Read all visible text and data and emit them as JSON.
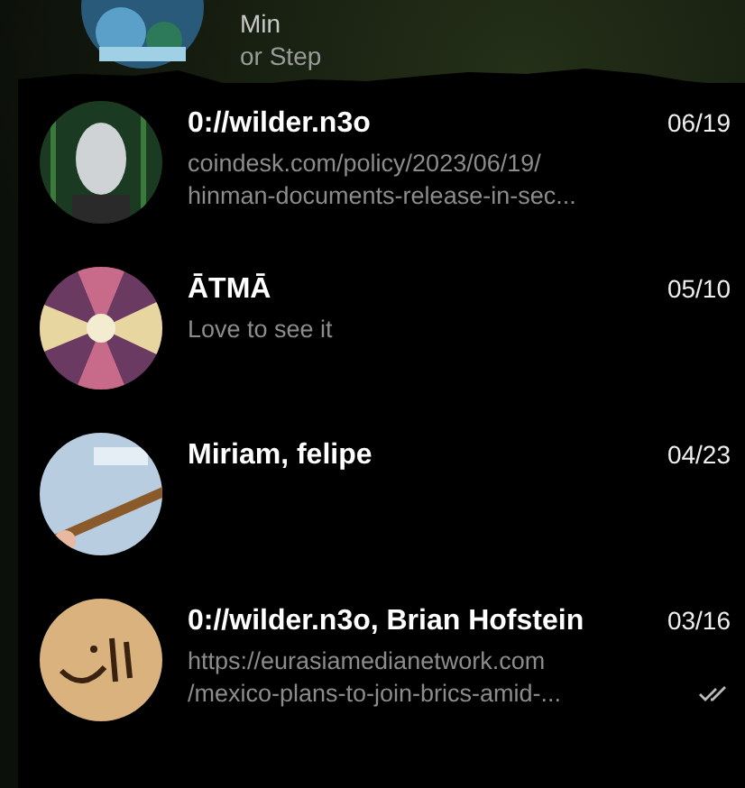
{
  "partial_row": {
    "lines": [
      "Min",
      "or Step"
    ]
  },
  "chats": [
    {
      "name": "0://wilder.n3o",
      "date": "06/19",
      "preview": [
        "coindesk.com/policy/2023/06/19/",
        "hinman-documents-release-in-sec..."
      ],
      "read": false
    },
    {
      "name": "ĀTMĀ",
      "date": "05/10",
      "preview": [
        "Love to see it"
      ],
      "read": false
    },
    {
      "name": "Miriam, felipe",
      "date": "04/23",
      "read": false
    },
    {
      "name": "0://wilder.n3o, Brian Hofstein",
      "date": "03/16",
      "preview": [
        "https://eurasiamedianetwork.com",
        "/mexico-plans-to-join-brics-amid-..."
      ],
      "read": true
    }
  ]
}
